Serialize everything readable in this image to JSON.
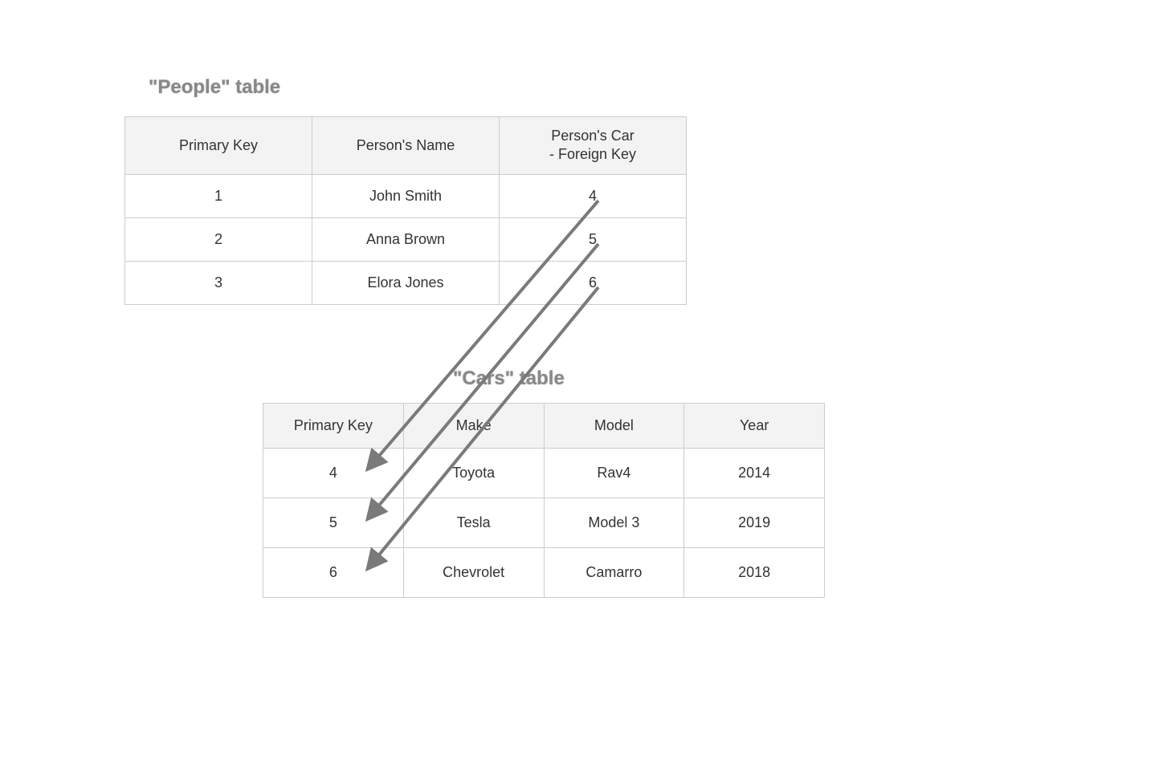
{
  "titles": {
    "people": "\"People\" table",
    "cars": "\"Cars\" table"
  },
  "peopleTable": {
    "headers": {
      "pk": "Primary Key",
      "name": "Person's Name",
      "fk": "Person's Car\n- Foreign Key"
    },
    "rows": [
      {
        "pk": "1",
        "name": "John Smith",
        "fk": "4"
      },
      {
        "pk": "2",
        "name": "Anna Brown",
        "fk": "5"
      },
      {
        "pk": "3",
        "name": "Elora Jones",
        "fk": "6"
      }
    ]
  },
  "carsTable": {
    "headers": {
      "pk": "Primary Key",
      "make": "Make",
      "model": "Model",
      "year": "Year"
    },
    "rows": [
      {
        "pk": "4",
        "make": "Toyota",
        "model": "Rav4",
        "year": "2014"
      },
      {
        "pk": "5",
        "make": "Tesla",
        "model": "Model 3",
        "year": "2019"
      },
      {
        "pk": "6",
        "make": "Chevrolet",
        "model": "Camarro",
        "year": "2018"
      }
    ]
  }
}
